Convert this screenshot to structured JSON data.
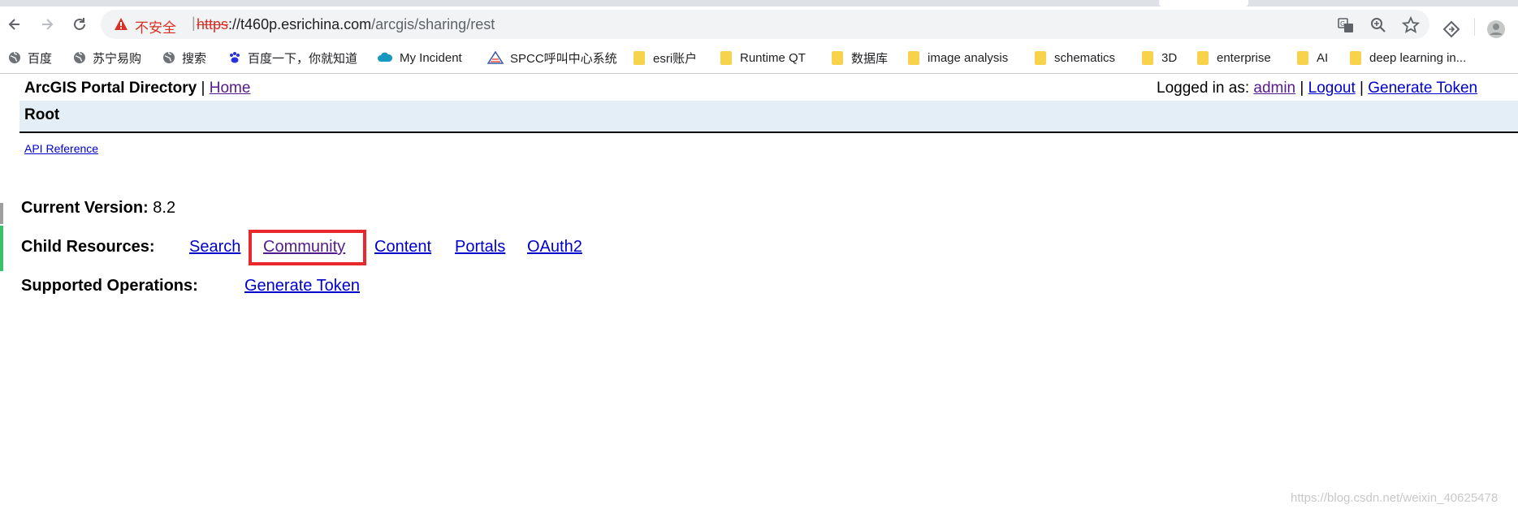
{
  "browser": {
    "omnibox": {
      "security_label": "不安全",
      "separator": "|",
      "url_scheme": "https",
      "url_sep": "://",
      "url_host": "t460p.esrichina.com",
      "url_path": "/arcgis/sharing/rest"
    },
    "bookmarks": [
      {
        "label": "百度",
        "icon": "globe-icon"
      },
      {
        "label": "苏宁易购",
        "icon": "globe-icon"
      },
      {
        "label": "搜索",
        "icon": "globe-icon"
      },
      {
        "label": "百度一下，你就知道",
        "icon": "baidu-paw-icon"
      },
      {
        "label": "My Incident",
        "icon": "cloud-icon"
      },
      {
        "label": "SPCC呼叫中心系统",
        "icon": "triangle-logo-icon"
      },
      {
        "label": "esri账户",
        "icon": "folder-icon"
      },
      {
        "label": "Runtime QT",
        "icon": "folder-icon"
      },
      {
        "label": "数据库",
        "icon": "folder-icon"
      },
      {
        "label": "image analysis",
        "icon": "folder-icon"
      },
      {
        "label": "schematics",
        "icon": "folder-icon"
      },
      {
        "label": "3D",
        "icon": "folder-icon"
      },
      {
        "label": "enterprise",
        "icon": "folder-icon"
      },
      {
        "label": "AI",
        "icon": "folder-icon"
      },
      {
        "label": "deep learning in...",
        "icon": "folder-icon"
      }
    ]
  },
  "page": {
    "header_title": "ArcGIS Portal Directory",
    "header_sep": "|",
    "home_link": "Home",
    "logged_in_label": "Logged in as:",
    "user_link": "admin",
    "logout_link": "Logout",
    "generate_token_link": "Generate Token",
    "pipe": "|",
    "root_title": "Root",
    "api_reference_link": "API Reference",
    "current_version_label": "Current Version:",
    "current_version_value": "8.2",
    "child_resources_label": "Child Resources:",
    "child_resources": [
      "Search",
      "Community",
      "Content",
      "Portals",
      "OAuth2"
    ],
    "supported_operations_label": "Supported Operations:",
    "supported_operations": [
      "Generate Token"
    ]
  },
  "watermark": "https://blog.csdn.net/weixin_40625478",
  "colors": {
    "link": "#0000cc",
    "visited_link": "#551a8b",
    "highlight_border": "#e8282d",
    "root_bar_bg": "#e4eef7",
    "insecure_red": "#d93025"
  }
}
